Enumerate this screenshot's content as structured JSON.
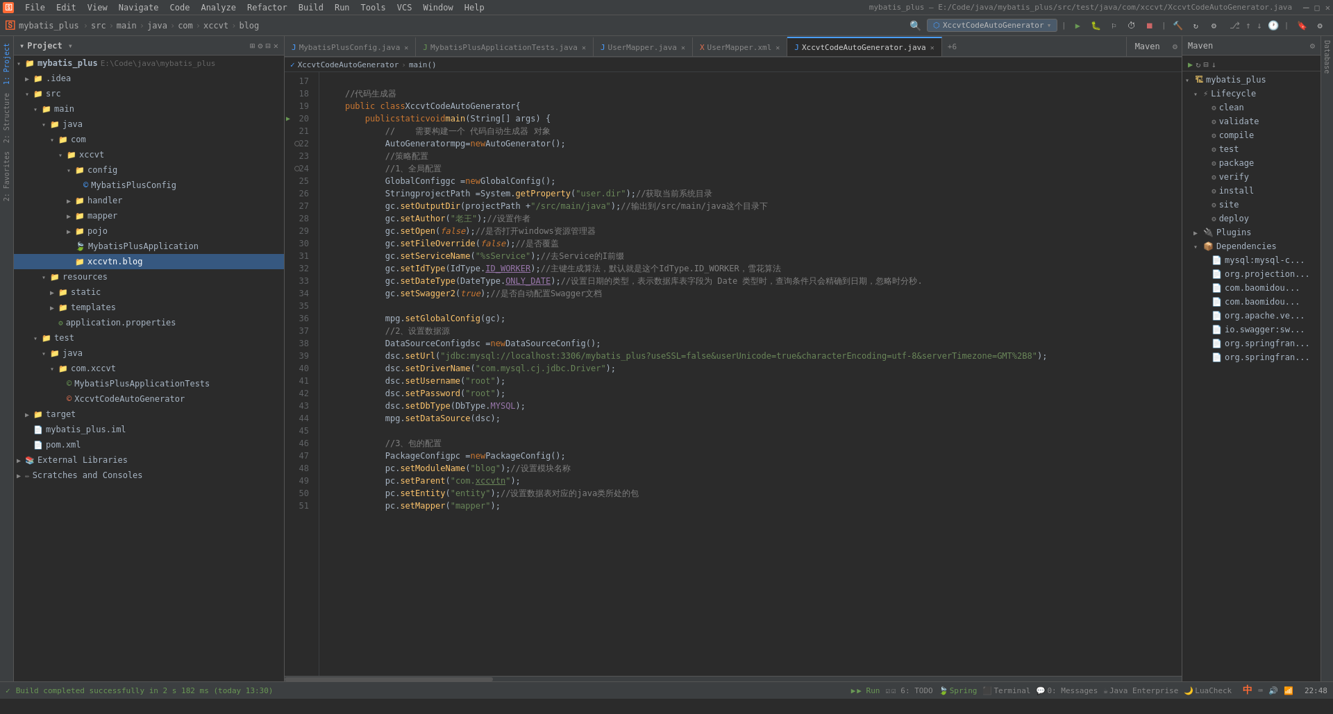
{
  "window": {
    "title": "mybatis_plus – E:/Code/java/mybatis_plus/src/test/java/com/xccvt/XccvtCodeAutoGenerator.java"
  },
  "menubar": {
    "items": [
      "File",
      "Edit",
      "View",
      "Navigate",
      "Code",
      "Analyze",
      "Refactor",
      "Build",
      "Run",
      "Tools",
      "VCS",
      "Window",
      "Help"
    ]
  },
  "toolbar": {
    "breadcrumbs": [
      "mybatis_plus",
      "src",
      "main",
      "java",
      "com",
      "xccvt",
      "blog"
    ],
    "run_config": "XccvtCodeAutoGenerator",
    "icons": [
      "search",
      "settings",
      "run",
      "debug",
      "coverage",
      "profile",
      "stop",
      "build",
      "refresh",
      "maven"
    ]
  },
  "tabs": [
    {
      "label": "MybatisPlusConfig.java",
      "active": false,
      "has_close": true,
      "icon": "java"
    },
    {
      "label": "MybatisPlusApplicationTests.java",
      "active": false,
      "has_close": true,
      "icon": "java"
    },
    {
      "label": "UserMapper.java",
      "active": false,
      "has_close": true,
      "icon": "java"
    },
    {
      "label": "UserMapper.xml",
      "active": false,
      "has_close": true,
      "icon": "xml"
    },
    {
      "label": "XccvtCodeAutoGenerator.java",
      "active": true,
      "has_close": true,
      "icon": "java"
    },
    {
      "label": "+6",
      "active": false,
      "has_close": false,
      "icon": ""
    }
  ],
  "breadcrumb": {
    "items": [
      "XccvtCodeAutoGenerator",
      "main()"
    ]
  },
  "project_panel": {
    "title": "Project",
    "root": {
      "name": "mybatis_plus",
      "path": "E:\\Code\\java\\mybatis_plus",
      "expanded": true,
      "children": [
        {
          "name": ".idea",
          "expanded": false,
          "type": "folder",
          "depth": 1
        },
        {
          "name": "src",
          "expanded": true,
          "type": "folder",
          "depth": 1,
          "children": [
            {
              "name": "main",
              "expanded": true,
              "type": "folder",
              "depth": 2,
              "children": [
                {
                  "name": "java",
                  "expanded": true,
                  "type": "folder",
                  "depth": 3,
                  "children": [
                    {
                      "name": "com",
                      "expanded": true,
                      "type": "folder",
                      "depth": 4,
                      "children": [
                        {
                          "name": "xccvt",
                          "expanded": true,
                          "type": "folder",
                          "depth": 5,
                          "children": [
                            {
                              "name": "config",
                              "expanded": true,
                              "type": "folder",
                              "depth": 6,
                              "children": [
                                {
                                  "name": "MybatisPlusConfig",
                                  "type": "java",
                                  "depth": 7
                                }
                              ]
                            },
                            {
                              "name": "handler",
                              "expanded": false,
                              "type": "folder",
                              "depth": 6
                            },
                            {
                              "name": "mapper",
                              "expanded": false,
                              "type": "folder",
                              "depth": 6
                            },
                            {
                              "name": "pojo",
                              "expanded": false,
                              "type": "folder",
                              "depth": 6
                            },
                            {
                              "name": "MybatisPlusApplication",
                              "type": "java",
                              "depth": 6
                            },
                            {
                              "name": "xccvtn.blog",
                              "type": "folder",
                              "depth": 6,
                              "active": true
                            }
                          ]
                        }
                      ]
                    }
                  ]
                },
                {
                  "name": "resources",
                  "expanded": true,
                  "type": "folder",
                  "depth": 3,
                  "children": [
                    {
                      "name": "static",
                      "expanded": false,
                      "type": "folder",
                      "depth": 4
                    },
                    {
                      "name": "templates",
                      "expanded": false,
                      "type": "folder",
                      "depth": 4
                    },
                    {
                      "name": "application.properties",
                      "type": "prop",
                      "depth": 4
                    }
                  ]
                }
              ]
            },
            {
              "name": "test",
              "expanded": true,
              "type": "folder",
              "depth": 2,
              "children": [
                {
                  "name": "java",
                  "expanded": true,
                  "type": "folder",
                  "depth": 3,
                  "children": [
                    {
                      "name": "com.xccvt",
                      "expanded": true,
                      "type": "folder",
                      "depth": 4,
                      "children": [
                        {
                          "name": "MybatisPlusApplicationTests",
                          "type": "java",
                          "depth": 5
                        },
                        {
                          "name": "XccvtCodeAutoGenerator",
                          "type": "java",
                          "depth": 5
                        }
                      ]
                    }
                  ]
                }
              ]
            }
          ]
        },
        {
          "name": "target",
          "expanded": false,
          "type": "folder",
          "depth": 1
        },
        {
          "name": "mybatis_plus.iml",
          "type": "iml",
          "depth": 1
        },
        {
          "name": "pom.xml",
          "type": "xml",
          "depth": 1
        },
        {
          "name": "External Libraries",
          "expanded": false,
          "type": "lib",
          "depth": 0
        },
        {
          "name": "Scratches and Consoles",
          "expanded": false,
          "type": "scratch",
          "depth": 0
        }
      ]
    }
  },
  "maven_panel": {
    "title": "Maven",
    "root": {
      "name": "mybatis_plus",
      "expanded": true,
      "children": [
        {
          "name": "Lifecycle",
          "expanded": true,
          "children": [
            {
              "name": "clean"
            },
            {
              "name": "validate"
            },
            {
              "name": "compile"
            },
            {
              "name": "test"
            },
            {
              "name": "package"
            },
            {
              "name": "verify"
            },
            {
              "name": "install"
            },
            {
              "name": "site"
            },
            {
              "name": "deploy"
            }
          ]
        },
        {
          "name": "Plugins",
          "expanded": false
        },
        {
          "name": "Dependencies",
          "expanded": true,
          "children": [
            {
              "name": "mysql:mysql-c..."
            },
            {
              "name": "org.projection..."
            },
            {
              "name": "com.baomidou..."
            },
            {
              "name": "com.baomidou..."
            },
            {
              "name": "org.apache.ve..."
            },
            {
              "name": "io.swagger:sw..."
            },
            {
              "name": "org.springfran..."
            },
            {
              "name": "org.springfran..."
            }
          ]
        }
      ]
    }
  },
  "code": {
    "filename": "XccvtCodeAutoGenerator.java",
    "lines": [
      {
        "num": 17,
        "content": ""
      },
      {
        "num": 18,
        "content": "    //代码生成器",
        "type": "comment"
      },
      {
        "num": 19,
        "content": "    public class XccvtCodeAutoGenerator {",
        "type": "class"
      },
      {
        "num": 20,
        "content": "        public static void main(String[] args) {",
        "type": "method",
        "has_run": true
      },
      {
        "num": 21,
        "content": "            //    需要构建一个 代码自动生成器 对象",
        "type": "comment"
      },
      {
        "num": 22,
        "content": "            AutoGenerator mpg= new AutoGenerator();",
        "type": "code"
      },
      {
        "num": 23,
        "content": "            //策略配置",
        "type": "comment"
      },
      {
        "num": 24,
        "content": "            //1、全局配置",
        "type": "comment"
      },
      {
        "num": 25,
        "content": "            GlobalConfig gc = new GlobalConfig();",
        "type": "code"
      },
      {
        "num": 26,
        "content": "            String projectPath = System.getProperty(\"user.dir\");//获取当前系统目录",
        "type": "code"
      },
      {
        "num": 27,
        "content": "            gc.setOutputDir(projectPath + \"/src/main/java\");//输出到/src/main/java这个目录下",
        "type": "code"
      },
      {
        "num": 28,
        "content": "            gc.setAuthor(\"老王\");//设置作者",
        "type": "code"
      },
      {
        "num": 29,
        "content": "            gc.setOpen(false);//是否打开windows资源管理器",
        "type": "code"
      },
      {
        "num": 30,
        "content": "            gc.setFileOverride(false);//是否覆盖",
        "type": "code"
      },
      {
        "num": 31,
        "content": "            gc.setServiceName(\"%sService\");//去Service的I前缀",
        "type": "code"
      },
      {
        "num": 32,
        "content": "            gc.setIdType(IdType.ID_WORKER);//主键生成算法，默认就是这个IdType.ID_WORKER，雪花算法",
        "type": "code"
      },
      {
        "num": 33,
        "content": "            gc.setDateType(DateType.ONLY_DATE);//设置日期的类型，表示数据库表字段为 Date 类型时，查询条件只会精确到日期，忽略时分秒.",
        "type": "code"
      },
      {
        "num": 34,
        "content": "            gc.setSwagger2(true);//是否自动配置Swagger文档",
        "type": "code"
      },
      {
        "num": 35,
        "content": ""
      },
      {
        "num": 36,
        "content": "            mpg.setGlobalConfig(gc);",
        "type": "code"
      },
      {
        "num": 37,
        "content": "            //2、设置数据源",
        "type": "comment"
      },
      {
        "num": 38,
        "content": "            DataSourceConfig dsc = new DataSourceConfig();",
        "type": "code"
      },
      {
        "num": 39,
        "content": "            dsc.setUrl(\"jdbc:mysql://localhost:3306/mybatis_plus?useSSL=false&userUnicode=true&characterEncoding=utf-8&serverTimezone=GMT%2B8\");",
        "type": "code"
      },
      {
        "num": 40,
        "content": "            dsc.setDriverName(\"com.mysql.cj.jdbc.Driver\");",
        "type": "code"
      },
      {
        "num": 41,
        "content": "            dsc.setUsername(\"root\");",
        "type": "code"
      },
      {
        "num": 42,
        "content": "            dsc.setPassword(\"root\");",
        "type": "code"
      },
      {
        "num": 43,
        "content": "            dsc.setDbType(DbType.MYSQL);",
        "type": "code"
      },
      {
        "num": 44,
        "content": "            mpg.setDataSource(dsc);",
        "type": "code"
      },
      {
        "num": 45,
        "content": ""
      },
      {
        "num": 46,
        "content": "            //3、包的配置",
        "type": "comment"
      },
      {
        "num": 47,
        "content": "            PackageConfig pc = new PackageConfig();",
        "type": "code"
      },
      {
        "num": 48,
        "content": "            pc.setModuleName(\"blog\");//设置模块名称",
        "type": "code"
      },
      {
        "num": 49,
        "content": "            pc.setParent(\"com.xccvtn\");",
        "type": "code"
      },
      {
        "num": 50,
        "content": "            pc.setEntity(\"entity\");//设置数据表对应的java类所处的包",
        "type": "code"
      },
      {
        "num": 51,
        "content": "            pc.setMapper(\"mapper\");",
        "type": "code"
      }
    ]
  },
  "status_bar": {
    "run_label": "▶ Run",
    "todo_label": "☑ 6: TODO",
    "spring_label": "Spring",
    "terminal_label": "Terminal",
    "messages_label": "0: Messages",
    "lua_label": "LuaCheck",
    "java_enterprise_label": "Java Enterprise",
    "build_status": "Build completed successfully in 2 s 182 ms (today 13:30)",
    "time": "22:48",
    "input_method": "中"
  }
}
